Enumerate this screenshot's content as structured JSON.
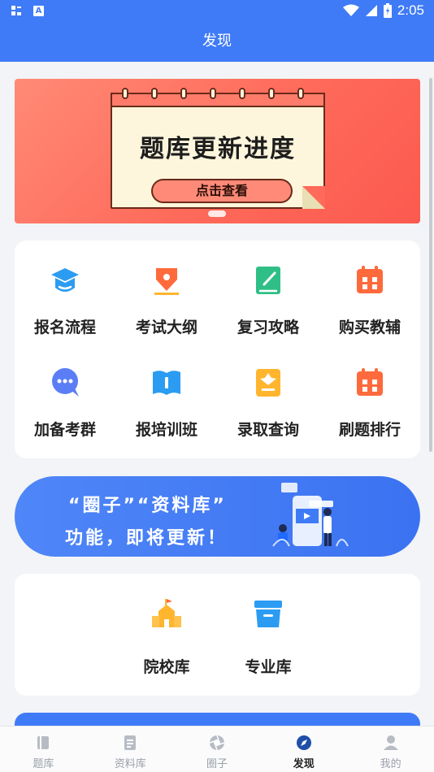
{
  "status_bar": {
    "time": "2:05"
  },
  "header": {
    "title": "发现"
  },
  "banner": {
    "title": "题库更新进度",
    "button": "点击查看"
  },
  "grid": {
    "items": [
      {
        "label": "报名流程",
        "icon": "graduation-cap-icon",
        "color": "#2b9cf2"
      },
      {
        "label": "考试大纲",
        "icon": "pen-nib-icon",
        "color": "#ff6a3c"
      },
      {
        "label": "复习攻略",
        "icon": "notebook-icon",
        "color": "#2fbf86"
      },
      {
        "label": "购买教辅",
        "icon": "calendar-icon",
        "color": "#ff6a3c"
      },
      {
        "label": "加备考群",
        "icon": "chat-bubble-icon",
        "color": "#5b7df6"
      },
      {
        "label": "报培训班",
        "icon": "open-book-icon",
        "color": "#2b9cf2"
      },
      {
        "label": "录取查询",
        "icon": "badge-icon",
        "color": "#ffb52e"
      },
      {
        "label": "刷题排行",
        "icon": "calendar-icon",
        "color": "#ff6a3c"
      }
    ]
  },
  "promo": {
    "line1": "“圈子”“资料库”",
    "line2": "功能，即将更新！"
  },
  "library": {
    "items": [
      {
        "label": "院校库",
        "icon": "school-icon",
        "color": "#ffb52e"
      },
      {
        "label": "专业库",
        "icon": "archive-box-icon",
        "color": "#2b9cf2"
      }
    ]
  },
  "tabbar": {
    "items": [
      {
        "label": "题库",
        "icon": "book-icon",
        "active": false
      },
      {
        "label": "资料库",
        "icon": "document-icon",
        "active": false
      },
      {
        "label": "圈子",
        "icon": "aperture-icon",
        "active": false
      },
      {
        "label": "发现",
        "icon": "compass-icon",
        "active": true
      },
      {
        "label": "我的",
        "icon": "user-icon",
        "active": false
      }
    ]
  },
  "colors": {
    "primary": "#3f7bf6",
    "banner": "#ff6a5a",
    "background": "#f2f4f7"
  }
}
